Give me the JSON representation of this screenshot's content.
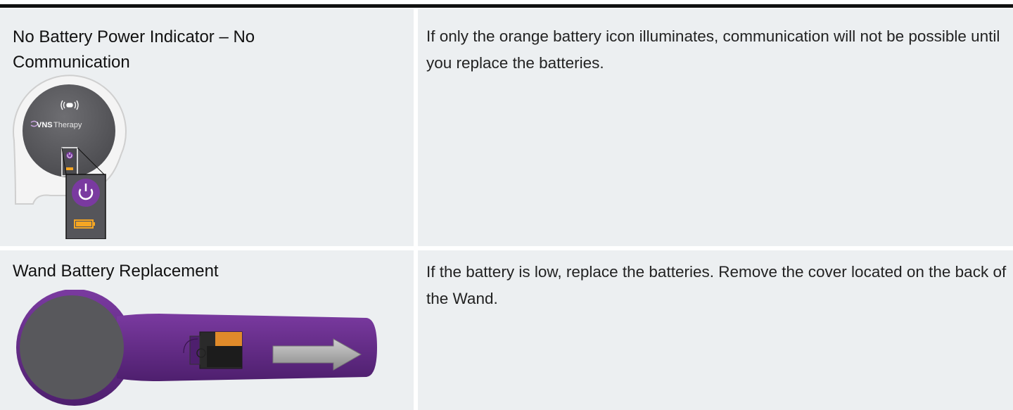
{
  "rows": [
    {
      "title": "No Battery Power Indicator – No Communication",
      "description": "If only the orange battery icon illuminates, communication will not be possible until you replace the batteries.",
      "image": {
        "logo_text": "VNS",
        "logo_text_2": "Therapy",
        "icons": [
          "wireless-wand-icon",
          "power-icon",
          "battery-icon"
        ]
      }
    },
    {
      "title": "Wand Battery Replacement",
      "description": "If the battery is low, replace the batteries. Remove the cover located on the back of the Wand.",
      "image": {
        "icons": [
          "wand-illustration",
          "arrow-right-icon",
          "battery-icon"
        ]
      }
    }
  ],
  "colors": {
    "cell_bg": "#eceff1",
    "purple": "#6b2d8c",
    "orange": "#f5a623",
    "wand_face": "#5a5a5e"
  }
}
